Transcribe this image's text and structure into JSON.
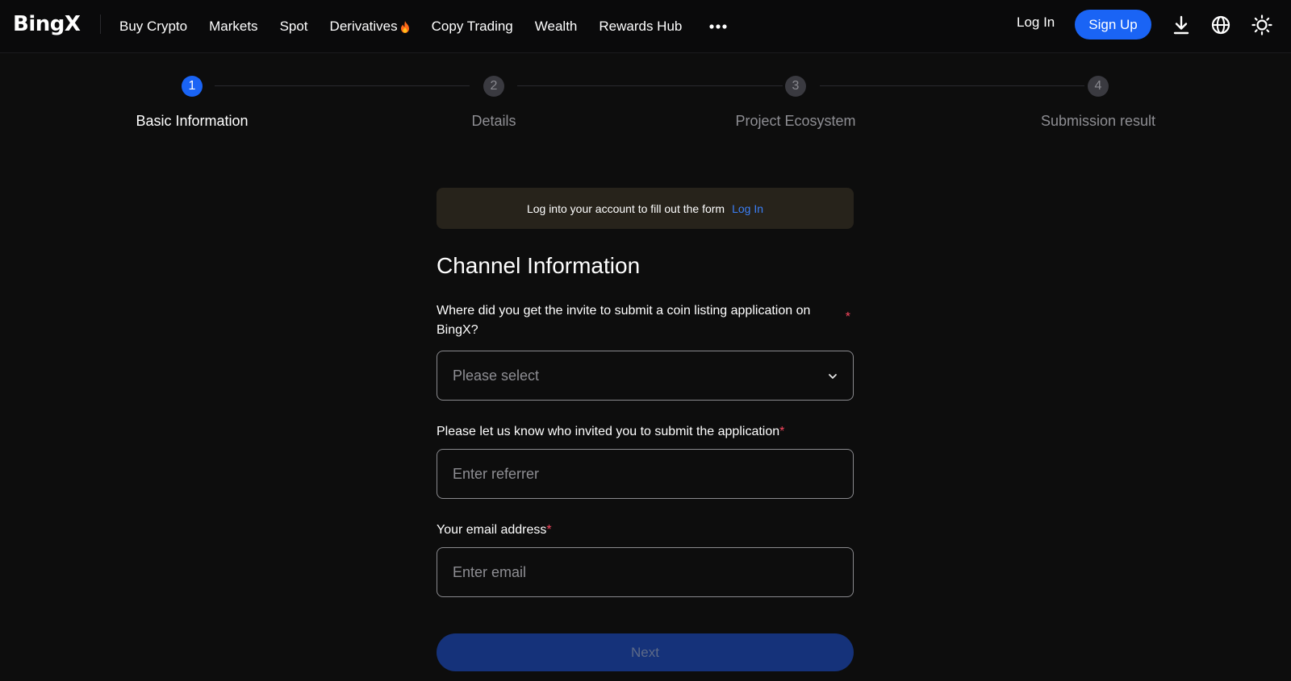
{
  "header": {
    "logo": "BingX",
    "nav": [
      {
        "label": "Buy Crypto"
      },
      {
        "label": "Markets"
      },
      {
        "label": "Spot"
      },
      {
        "label": "Derivatives"
      },
      {
        "label": "Copy Trading"
      },
      {
        "label": "Wealth"
      },
      {
        "label": "Rewards Hub"
      }
    ],
    "more_icon": "more-dots-icon",
    "login": "Log In",
    "signup": "Sign Up",
    "icons": [
      "download-icon",
      "globe-icon",
      "sun-icon"
    ],
    "accent": "#1a64f5"
  },
  "stepper": {
    "steps": [
      {
        "number": "1",
        "label": "Basic Information",
        "active": true
      },
      {
        "number": "2",
        "label": "Details",
        "active": false
      },
      {
        "number": "3",
        "label": "Project Ecosystem",
        "active": false
      },
      {
        "number": "4",
        "label": "Submission result",
        "active": false
      }
    ]
  },
  "form": {
    "banner_text": "Log into your account to fill out the form",
    "banner_link": "Log In",
    "section_title": "Channel Information",
    "fields": [
      {
        "label": "Where did you get the invite to submit a coin listing application on BingX?",
        "required": "*",
        "placeholder": "Please select",
        "type": "select"
      },
      {
        "label": "Please let us know who invited you to submit the application",
        "required": "*",
        "placeholder": "Enter referrer",
        "type": "input"
      },
      {
        "label": "Your email address",
        "required": "*",
        "placeholder": "Enter email",
        "type": "input"
      }
    ],
    "next": "Next"
  }
}
